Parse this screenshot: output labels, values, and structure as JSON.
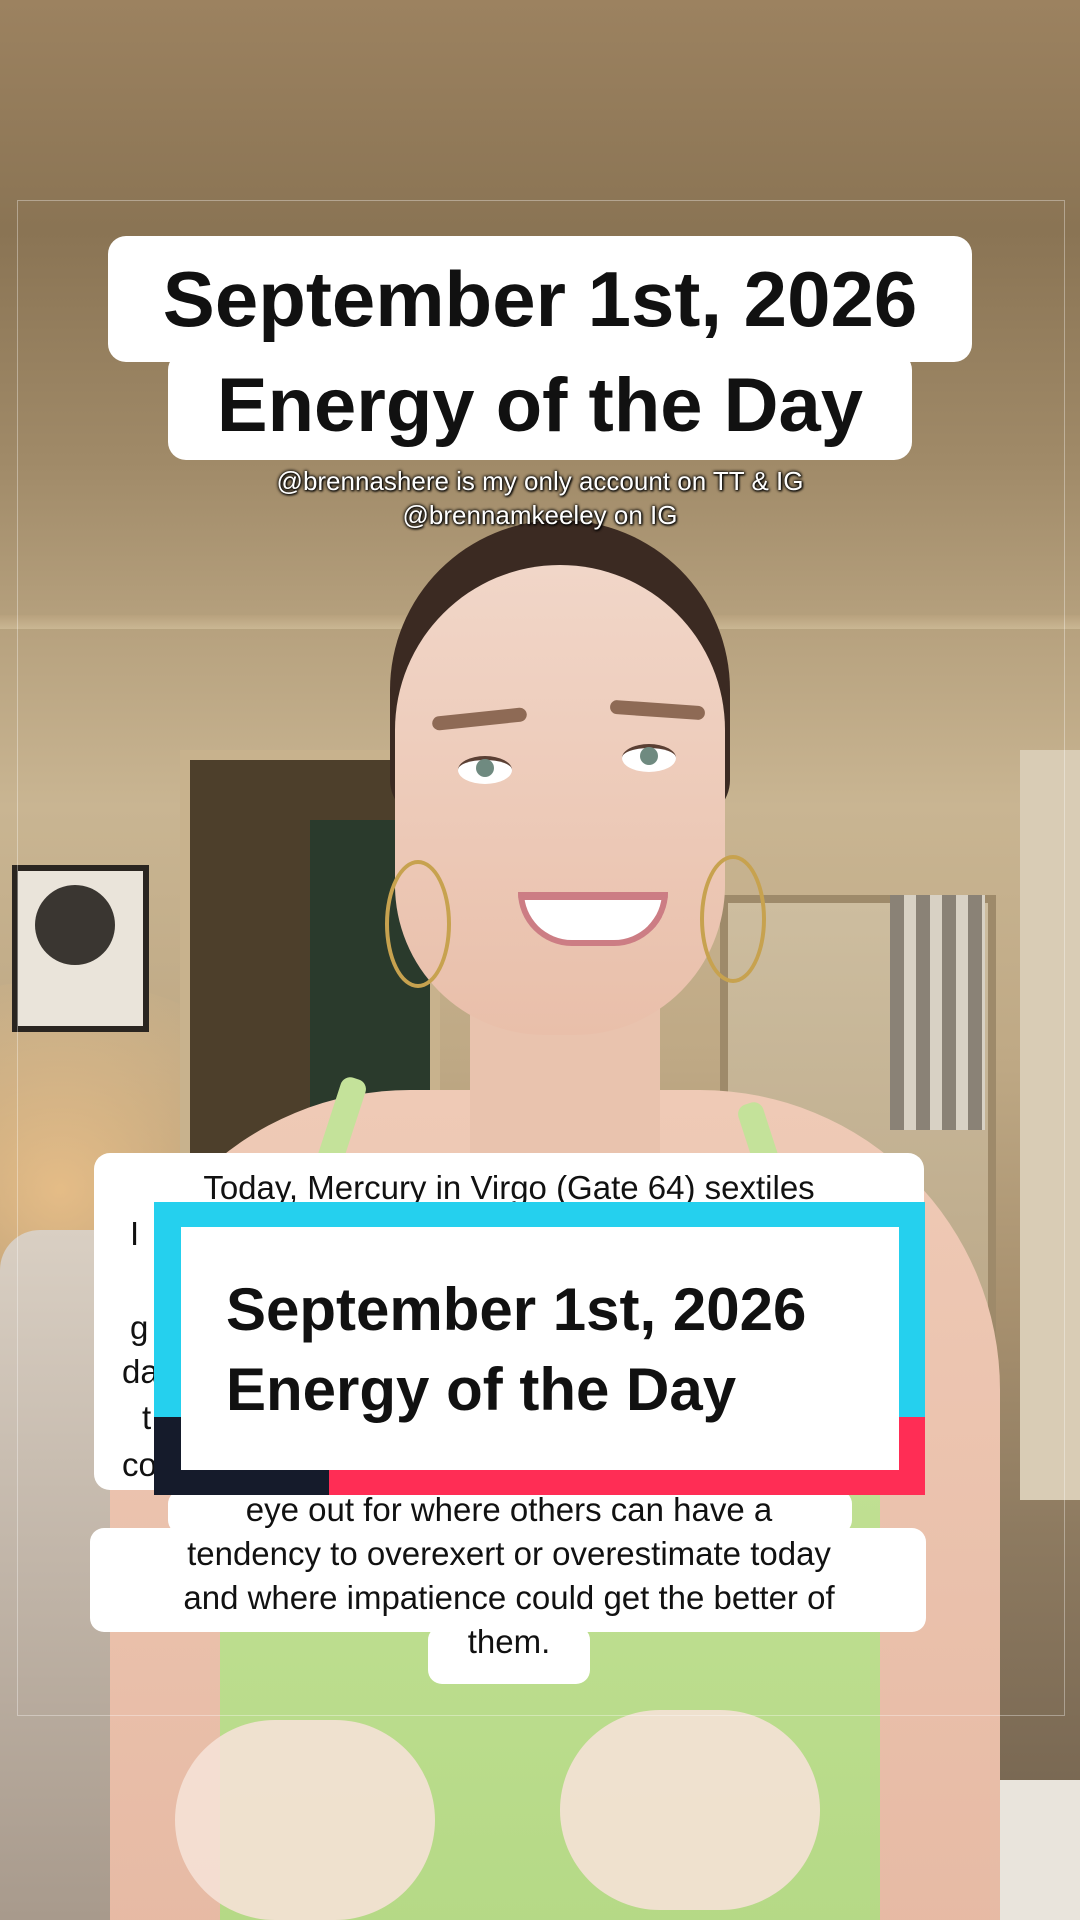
{
  "overlay": {
    "title_line1": "September 1st, 2026",
    "title_line2": "Energy of the Day",
    "handle_line1": "@brennashere is my only account on TT & IG",
    "handle_line2": "@brennamkeeley on IG"
  },
  "caption": {
    "line1": "Today, Mercury in Virgo (Gate 64) sextiles",
    "partial": [
      "I",
      "g",
      "da",
      "t",
      "co"
    ],
    "line2": "eye out for where others can have a",
    "line3": "tendency to overexert or overestimate today",
    "line4": "and where impatience could get the better of",
    "line5": "them."
  },
  "title_card": {
    "line1": "September 1st, 2026",
    "line2": "Energy of the Day",
    "colors": {
      "cyan": "#25d0ee",
      "red": "#ff2d55",
      "dark": "#151b2b"
    }
  }
}
